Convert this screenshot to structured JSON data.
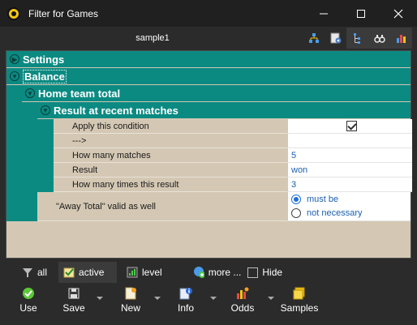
{
  "window": {
    "title": "Filter for Games",
    "minimize": "—",
    "maximize": "☐",
    "close": "✕"
  },
  "toolbar_top": {
    "sample_name": "sample1",
    "icons": [
      "network-icon",
      "settings-page-icon",
      "tree-icon",
      "binoculars-icon",
      "bar-chart-icon"
    ]
  },
  "grid": {
    "sections": {
      "settings": "Settings",
      "balance": "Balance",
      "home_team_total": "Home team total",
      "result_recent": "Result at recent matches"
    },
    "rows": [
      {
        "name": "Apply this condition",
        "value": ""
      },
      {
        "name": "--->",
        "value": ""
      },
      {
        "name": "How many matches",
        "value": "5"
      },
      {
        "name": "Result",
        "value": "won"
      },
      {
        "name": "How many times this result",
        "value": "3"
      }
    ],
    "away_total": {
      "name": "\"Away Total\" valid as well",
      "options": [
        "must be",
        "not necessary"
      ],
      "selected": "must be"
    },
    "colors": {
      "section_bg": "#0b8a82",
      "grid_bg": "#d4c8b4",
      "value_text": "#1c5fb0"
    }
  },
  "filter_bar": {
    "all": "all",
    "active": "active",
    "level": "level",
    "more": "more ...",
    "hide": "Hide"
  },
  "bottom_bar": {
    "use": "Use",
    "save": "Save",
    "new": "New",
    "info": "Info",
    "odds": "Odds",
    "samples": "Samples"
  }
}
